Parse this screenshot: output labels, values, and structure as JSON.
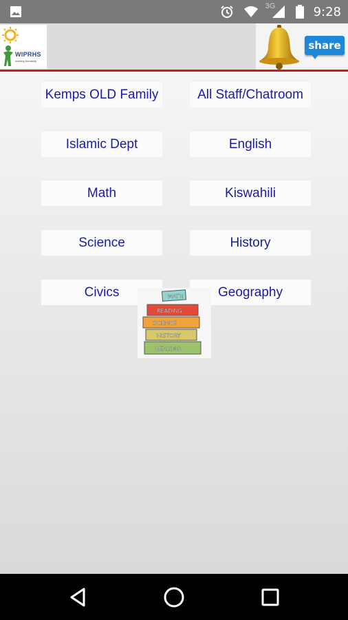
{
  "status_bar": {
    "time": "9:28",
    "network": "3G",
    "icons": [
      "gallery-icon",
      "alarm-icon",
      "wifi-icon",
      "signal-icon",
      "battery-icon"
    ]
  },
  "header": {
    "logo_text": "WIPRHS",
    "logo_sub": "working humanity",
    "bell_icon": "bell-icon",
    "share_label": "share"
  },
  "menu": [
    {
      "label": "Kemps OLD Family"
    },
    {
      "label": "All Staff/Chatroom"
    },
    {
      "label": "Islamic Dept"
    },
    {
      "label": "English"
    },
    {
      "label": "Math"
    },
    {
      "label": "Kiswahili"
    },
    {
      "label": "Science"
    },
    {
      "label": "History"
    },
    {
      "label": "Civics"
    },
    {
      "label": "Geography"
    }
  ],
  "books_image": {
    "spines": [
      "MATH",
      "READING",
      "SCIENCE",
      "HISTORY",
      "READING"
    ],
    "colors": [
      "#8fd6d2",
      "#e34a3a",
      "#f2a23a",
      "#d8c86a",
      "#9bc36b"
    ]
  },
  "nav": {
    "back": "back-icon",
    "home": "home-icon",
    "recents": "recents-icon"
  },
  "colors": {
    "accent_red": "#d01818",
    "button_text": "#1a1aa6",
    "share_blue": "#1e88d8"
  }
}
